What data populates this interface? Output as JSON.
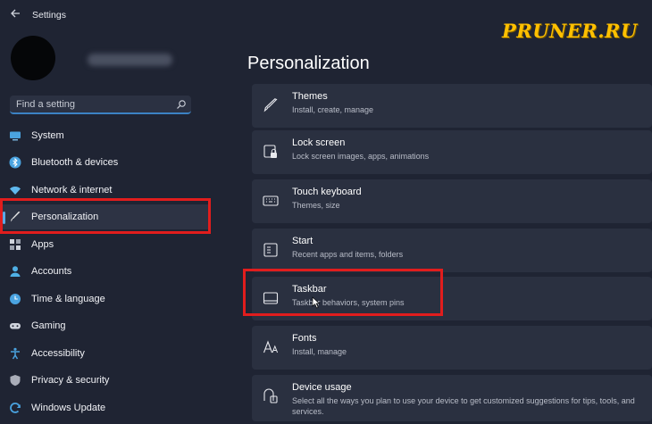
{
  "window": {
    "title": "Settings"
  },
  "watermark": "PRUNER.RU",
  "search": {
    "placeholder": "Find a setting"
  },
  "sidebar": {
    "items": [
      {
        "label": "System",
        "icon": "monitor-icon",
        "color": "#4aa3e0"
      },
      {
        "label": "Bluetooth & devices",
        "icon": "bluetooth-icon",
        "color": "#4aa3e0"
      },
      {
        "label": "Network & internet",
        "icon": "wifi-icon",
        "color": "#5fb8ee"
      },
      {
        "label": "Personalization",
        "icon": "brush-icon",
        "color": "#e6e6e6",
        "selected": true
      },
      {
        "label": "Apps",
        "icon": "apps-icon",
        "color": "#cfd3dc"
      },
      {
        "label": "Accounts",
        "icon": "person-icon",
        "color": "#4fb0e6"
      },
      {
        "label": "Time & language",
        "icon": "globe-clock-icon",
        "color": "#4aa3e0"
      },
      {
        "label": "Gaming",
        "icon": "gamepad-icon",
        "color": "#cfd3dc"
      },
      {
        "label": "Accessibility",
        "icon": "accessibility-icon",
        "color": "#4aa3e0"
      },
      {
        "label": "Privacy & security",
        "icon": "shield-icon",
        "color": "#a9adb8"
      },
      {
        "label": "Windows Update",
        "icon": "refresh-icon",
        "color": "#4aa3e0"
      }
    ]
  },
  "main": {
    "title": "Personalization",
    "cards": [
      {
        "title": "Themes",
        "subtitle": "Install, create, manage",
        "icon": "brush-icon"
      },
      {
        "title": "Lock screen",
        "subtitle": "Lock screen images, apps, animations",
        "icon": "lock-screen-icon"
      },
      {
        "title": "Touch keyboard",
        "subtitle": "Themes, size",
        "icon": "keyboard-icon"
      },
      {
        "title": "Start",
        "subtitle": "Recent apps and items, folders",
        "icon": "start-icon"
      },
      {
        "title": "Taskbar",
        "subtitle": "Taskbar behaviors, system pins",
        "icon": "taskbar-icon"
      },
      {
        "title": "Fonts",
        "subtitle": "Install, manage",
        "icon": "fonts-icon"
      },
      {
        "title": "Device usage",
        "subtitle": "Select all the ways you plan to use your device to get customized suggestions for tips, tools, and services.",
        "icon": "device-usage-icon"
      }
    ]
  },
  "accent": "#3b82c4",
  "highlight": "#e11d1d"
}
